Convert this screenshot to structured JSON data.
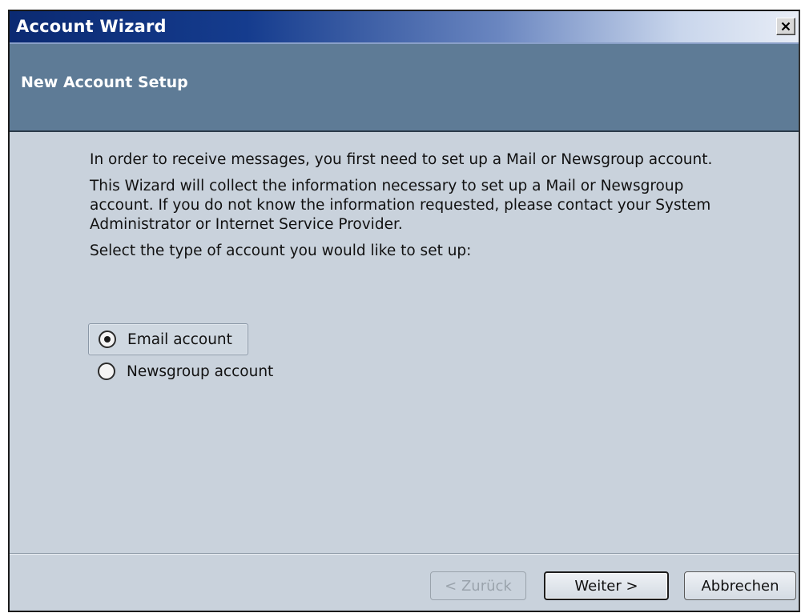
{
  "window": {
    "title": "Account Wizard",
    "close_label": "×"
  },
  "header": {
    "title": "New Account Setup"
  },
  "content": {
    "paragraph1": "In order to receive messages, you first need to set up a Mail or Newsgroup account.",
    "paragraph2": "This Wizard will collect the information necessary to set up a Mail or Newsgroup account. If you do not know the information requested, please contact your System Administrator or Internet Service Provider.",
    "prompt": "Select the type of account you would like to set up:"
  },
  "account_types": [
    {
      "label": "Email account",
      "selected": true
    },
    {
      "label": "Newsgroup account",
      "selected": false
    }
  ],
  "buttons": {
    "back": "< Zurück",
    "next": "Weiter >",
    "cancel": "Abbrechen"
  },
  "icons": {
    "close": "close-icon"
  },
  "colors": {
    "titlebar_start": "#0b2a72",
    "header_band": "#5e7b96",
    "dialog_background": "#c9d2dc"
  }
}
